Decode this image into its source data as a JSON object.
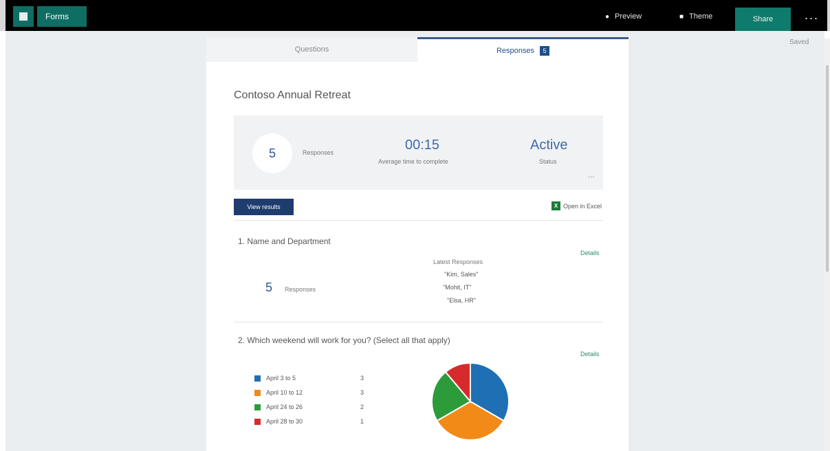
{
  "topbar": {
    "app_name": "Forms",
    "preview_label": "Preview",
    "theme_label": "Theme",
    "share_label": "Share",
    "more_label": "···"
  },
  "status": {
    "saved_label": "Saved"
  },
  "tabs": [
    {
      "label": "Questions",
      "active": false
    },
    {
      "label": "Responses",
      "active": true,
      "badge": "5"
    }
  ],
  "form": {
    "title": "Contoso Annual Retreat"
  },
  "summary": {
    "responses_count": "5",
    "responses_label": "Responses",
    "avg_time": "00:15",
    "avg_time_label": "Average time to complete",
    "status": "Active",
    "status_label": "Status",
    "more_label": "···"
  },
  "actions": {
    "view_results_label": "View results",
    "open_excel_label": "Open in Excel",
    "excel_icon": "excel-icon"
  },
  "questions": [
    {
      "title": "1. Name and Department",
      "details_label": "Details",
      "responses_count": "5",
      "responses_label": "Responses",
      "latest_header": "Latest Responses",
      "latest": [
        "\"Kim, Sales\"",
        "\"Mohit, IT\"",
        "\"Elsa, HR\""
      ]
    },
    {
      "title": "2. Which weekend will work for you? (Select all that apply)",
      "details_label": "Details",
      "options": [
        {
          "label": "April 3 to 5",
          "count": "3",
          "color": "#1f6fb4"
        },
        {
          "label": "April 10 to 12",
          "count": "3",
          "color": "#f28a18"
        },
        {
          "label": "April 24 to 26",
          "count": "2",
          "color": "#2c9b3a"
        },
        {
          "label": "April 28 to 30",
          "count": "1",
          "color": "#d62b2b"
        }
      ]
    }
  ],
  "chart_data": {
    "type": "pie",
    "categories": [
      "April 3 to 5",
      "April 10 to 12",
      "April 24 to 26",
      "April 28 to 30"
    ],
    "values": [
      3,
      3,
      2,
      1
    ],
    "colors": [
      "#1f6fb4",
      "#f28a18",
      "#2c9b3a",
      "#d62b2b"
    ]
  }
}
